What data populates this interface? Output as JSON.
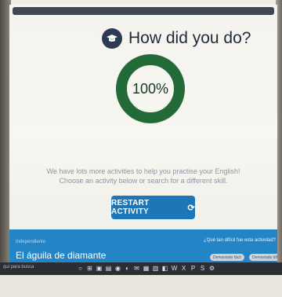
{
  "page": {
    "title": "How did you do?",
    "score": "100%",
    "score_fraction": 1.0,
    "message_line1": "We have lots more activities to help you practise your English!",
    "message_line2": "Choose an activity below or search for a different skill.",
    "restart_label": "RESTART ACTIVITY"
  },
  "footer": {
    "level": "Independiente",
    "book_title": "El águila de diamante",
    "difficulty_question": "¿Qué tan difícil fue esta actividad?",
    "option1": "Demasiado fácil",
    "option2": "Demasiado difícil"
  },
  "taskbar": {
    "search": "qui para busca"
  },
  "colors": {
    "ring": "#226b38",
    "button": "#1d76b8",
    "footer": "#2385c6",
    "header_bar": "#3f4754"
  }
}
